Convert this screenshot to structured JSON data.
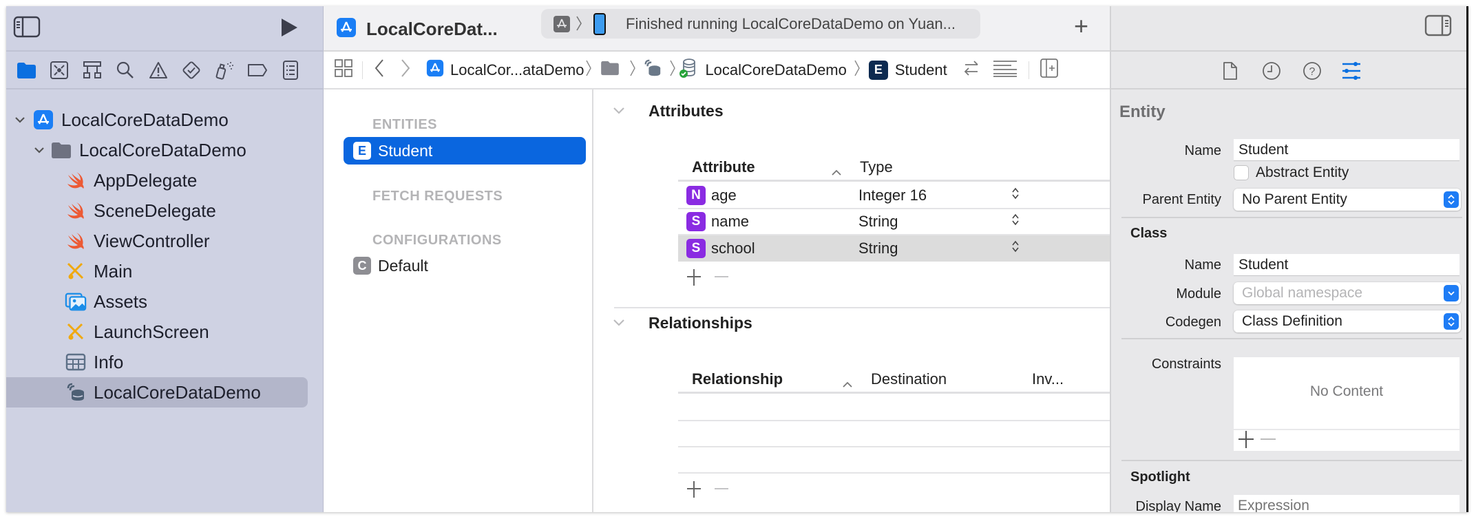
{
  "navigator": {
    "tabs": [
      {
        "name": "project-navigator",
        "icon": "folder-icon",
        "active": true
      },
      {
        "name": "source-control-navigator",
        "icon": "source-control-icon"
      },
      {
        "name": "symbol-navigator",
        "icon": "hierarchy-icon"
      },
      {
        "name": "find-navigator",
        "icon": "search-icon"
      },
      {
        "name": "issue-navigator",
        "icon": "warning-icon"
      },
      {
        "name": "test-navigator",
        "icon": "test-diamond-icon"
      },
      {
        "name": "debug-navigator",
        "icon": "spray-icon"
      },
      {
        "name": "breakpoint-navigator",
        "icon": "breakpoint-icon"
      },
      {
        "name": "report-navigator",
        "icon": "report-icon"
      }
    ],
    "tree": [
      {
        "label": "LocalCoreDataDemo",
        "kind": "project",
        "icon": "app-project-icon",
        "expanded": true,
        "level": 0
      },
      {
        "label": "LocalCoreDataDemo",
        "kind": "group",
        "icon": "folder-icon",
        "expanded": true,
        "level": 1
      },
      {
        "label": "AppDelegate",
        "kind": "swift",
        "icon": "swift-icon",
        "level": 2
      },
      {
        "label": "SceneDelegate",
        "kind": "swift",
        "icon": "swift-icon",
        "level": 2
      },
      {
        "label": "ViewController",
        "kind": "swift",
        "icon": "swift-icon",
        "level": 2
      },
      {
        "label": "Main",
        "kind": "storyboard",
        "icon": "storyboard-icon",
        "level": 2
      },
      {
        "label": "Assets",
        "kind": "assets",
        "icon": "assets-icon",
        "level": 2
      },
      {
        "label": "LaunchScreen",
        "kind": "storyboard",
        "icon": "storyboard-icon",
        "level": 2
      },
      {
        "label": "Info",
        "kind": "plist",
        "icon": "plist-table-icon",
        "level": 2
      },
      {
        "label": "LocalCoreDataDemo",
        "kind": "datamodel",
        "icon": "datamodel-icon",
        "level": 2,
        "selected": true
      }
    ]
  },
  "toolbar": {
    "project_title": "LocalCoreDat...",
    "status_text": "Finished running LocalCoreDataDemo on Yuan...",
    "add_label": "+"
  },
  "jumpbar": {
    "crumbs": [
      {
        "label": "LocalCor...ataDemo",
        "icon": "app-project-icon"
      },
      {
        "label": "",
        "icon": "folder-icon"
      },
      {
        "label": "",
        "icon": "datamodel-icon"
      },
      {
        "label": "LocalCoreDataDemo",
        "icon": "datamodel-version-check-icon"
      },
      {
        "label": "Student",
        "icon": "entity-badge-icon",
        "badge": "E"
      }
    ]
  },
  "entity_list": {
    "sections": {
      "entities": "ENTITIES",
      "fetch_requests": "FETCH REQUESTS",
      "configurations": "CONFIGURATIONS"
    },
    "entities": [
      {
        "badge": "E",
        "label": "Student",
        "selected": true
      }
    ],
    "configurations": [
      {
        "badge": "C",
        "label": "Default"
      }
    ]
  },
  "attributes": {
    "title": "Attributes",
    "columns": [
      "Attribute",
      "Type"
    ],
    "rows": [
      {
        "badge": "N",
        "name": "age",
        "type": "Integer 16"
      },
      {
        "badge": "S",
        "name": "name",
        "type": "String"
      },
      {
        "badge": "S",
        "name": "school",
        "type": "String",
        "selected": true
      }
    ]
  },
  "relationships": {
    "title": "Relationships",
    "columns": [
      "Relationship",
      "Destination",
      "Inv..."
    ],
    "rows": []
  },
  "inspector": {
    "entity_heading": "Entity",
    "name_label": "Name",
    "name_value": "Student",
    "abstract_label": "Abstract Entity",
    "abstract_checked": false,
    "parent_label": "Parent Entity",
    "parent_value": "No Parent Entity",
    "class_heading": "Class",
    "class_name_label": "Name",
    "class_name_value": "Student",
    "module_label": "Module",
    "module_placeholder": "Global namespace",
    "codegen_label": "Codegen",
    "codegen_value": "Class Definition",
    "constraints_label": "Constraints",
    "constraints_empty": "No Content",
    "spotlight_heading": "Spotlight",
    "display_name_label": "Display Name",
    "display_name_placeholder": "Expression"
  },
  "colors": {
    "accent": "#0a6fe0",
    "navigator_bg": "#cfd2e3",
    "attribute_badge": "#8a2be2",
    "swift": "#f05138",
    "storyboard": "#f0a90f"
  }
}
